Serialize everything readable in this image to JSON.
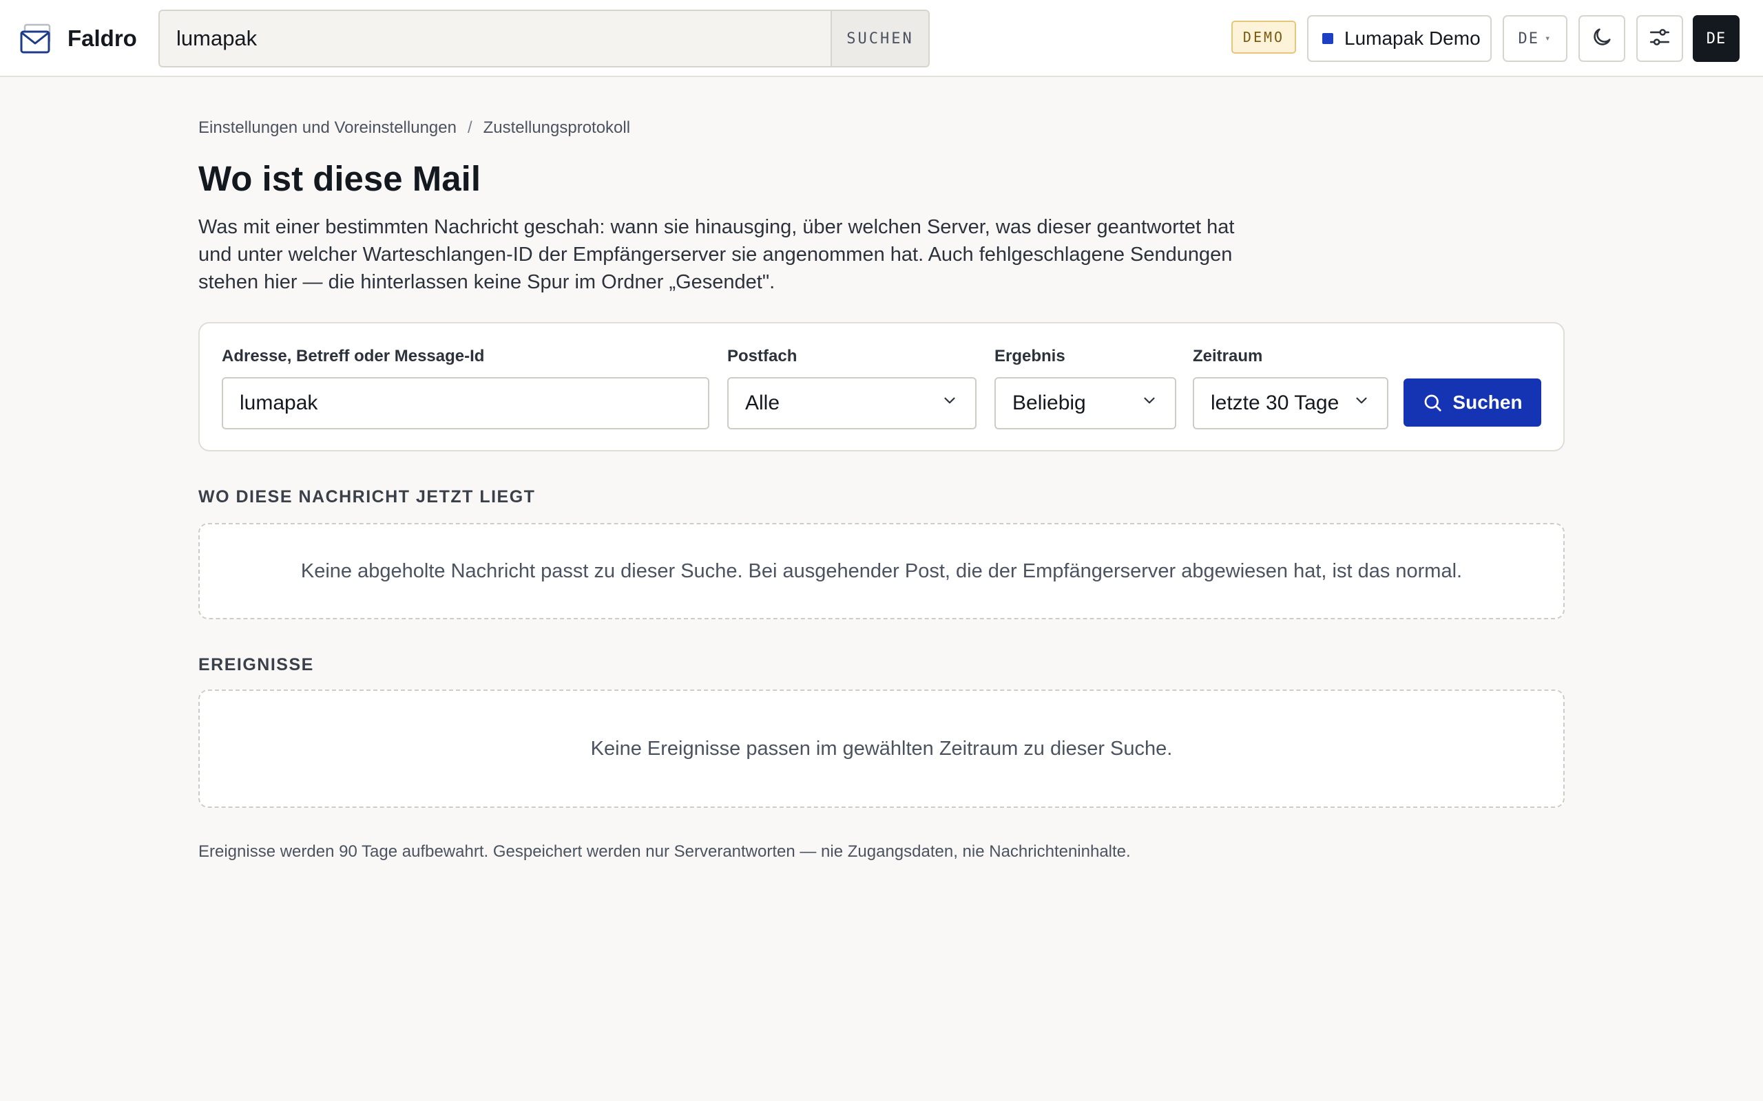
{
  "app": {
    "name": "Faldro"
  },
  "topbar": {
    "search_value": "lumapak",
    "search_button": "SUCHEN",
    "demo_badge": "DEMO",
    "account_name": "Lumapak Demo",
    "account_color": "#1d3fc4",
    "language": "DE",
    "avatar_initials": "DE",
    "icons": [
      "mail-logo-icon",
      "moon-icon",
      "sliders-icon",
      "caret-down-icon"
    ]
  },
  "breadcrumb": {
    "parent": "Einstellungen und Voreinstellungen",
    "separator": "/",
    "current": "Zustellungsprotokoll"
  },
  "page": {
    "title": "Wo ist diese Mail",
    "description": "Was mit einer bestimmten Nachricht geschah: wann sie hinausging, über welchen Server, was dieser geantwortet hat und unter welcher Warteschlangen-ID der Empfängerserver sie angenommen hat. Auch fehlgeschlagene Sendungen stehen hier — die hinterlassen keine Spur im Ordner „Gesendet\"."
  },
  "filters": {
    "query": {
      "label": "Adresse, Betreff oder Message-Id",
      "value": "lumapak"
    },
    "mailbox": {
      "label": "Postfach",
      "value": "Alle"
    },
    "result": {
      "label": "Ergebnis",
      "value": "Beliebig"
    },
    "period": {
      "label": "Zeitraum",
      "value": "letzte 30 Tage"
    },
    "submit_label": "Suchen",
    "submit_color": "#1434b4"
  },
  "location_section": {
    "title": "WO DIESE NACHRICHT JETZT LIEGT",
    "empty_text": "Keine abgeholte Nachricht passt zu dieser Suche. Bei ausgehender Post, die der Empfängerserver abgewiesen hat, ist das normal."
  },
  "events_section": {
    "title": "EREIGNISSE",
    "empty_text": "Keine Ereignisse passen im gewählten Zeitraum zu dieser Suche."
  },
  "footnote": "Ereignisse werden 90 Tage aufbewahrt. Gespeichert werden nur Serverantworten — nie Zugangsdaten, nie Nachrichteninhalte."
}
